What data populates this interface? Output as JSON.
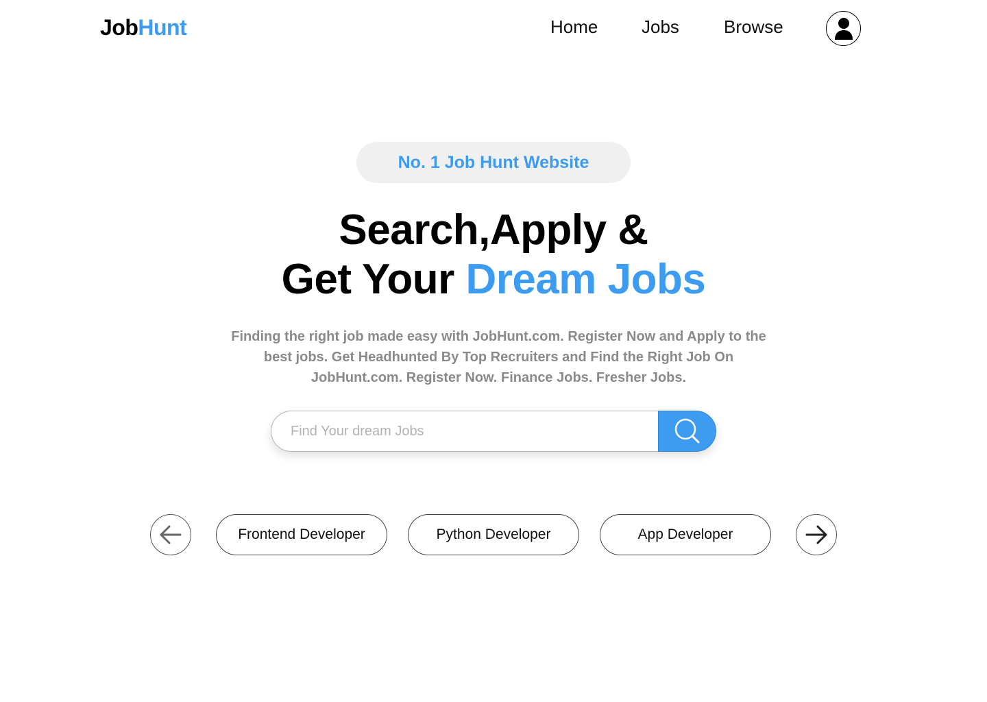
{
  "brand": {
    "logo_part1": "Job",
    "logo_part2": "Hunt",
    "accent_color": "#3d9cf0"
  },
  "nav": {
    "links": [
      "Home",
      "Jobs",
      "Browse"
    ],
    "profile_icon": "user-icon"
  },
  "hero": {
    "badge": "No. 1 Job Hunt Website",
    "headline_line1": "Search,Apply &",
    "headline_line2_plain": "Get Your ",
    "headline_line2_accent": "Dream Jobs",
    "description": "Finding the right job made easy with JobHunt.com. Register Now and Apply to the best jobs. Get Headhunted By Top Recruiters and Find the Right Job On JobHunt.com.  Register Now. Finance Jobs. Fresher Jobs."
  },
  "search": {
    "placeholder": "Find Your dream Jobs",
    "value": "",
    "button_icon": "search-icon"
  },
  "categories": {
    "prev_icon": "arrow-left-icon",
    "next_icon": "arrow-right-icon",
    "items": [
      "Frontend Developer",
      "Python Developer",
      "App Developer"
    ]
  }
}
